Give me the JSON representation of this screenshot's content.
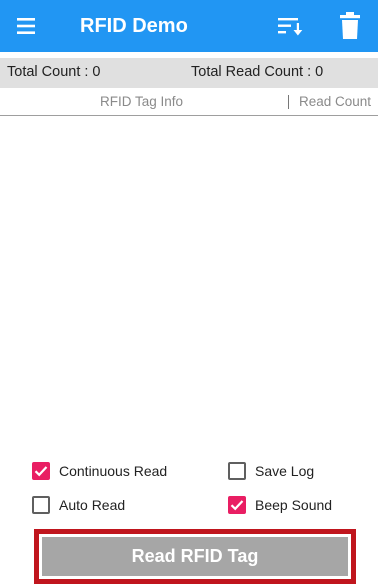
{
  "toolbar": {
    "title": "RFID Demo",
    "background_color": "#2196f3",
    "menu_icon": "hamburger-menu-icon",
    "sort_icon": "sort-icon",
    "delete_icon": "trash-icon"
  },
  "counts": {
    "total_count": "Total Count : 0",
    "total_read_count": "Total Read Count : 0"
  },
  "columns": {
    "tag_info": "RFID Tag Info",
    "read_count": "Read Count"
  },
  "tags": [],
  "options": {
    "continuous_read": {
      "label": "Continuous Read",
      "checked": true
    },
    "save_log": {
      "label": "Save Log",
      "checked": false
    },
    "auto_read": {
      "label": "Auto Read",
      "checked": false
    },
    "beep_sound": {
      "label": "Beep Sound",
      "checked": true
    },
    "checked_color": "#e91e63"
  },
  "read_button": {
    "label": "Read RFID Tag",
    "highlight_color": "#c0151d"
  }
}
